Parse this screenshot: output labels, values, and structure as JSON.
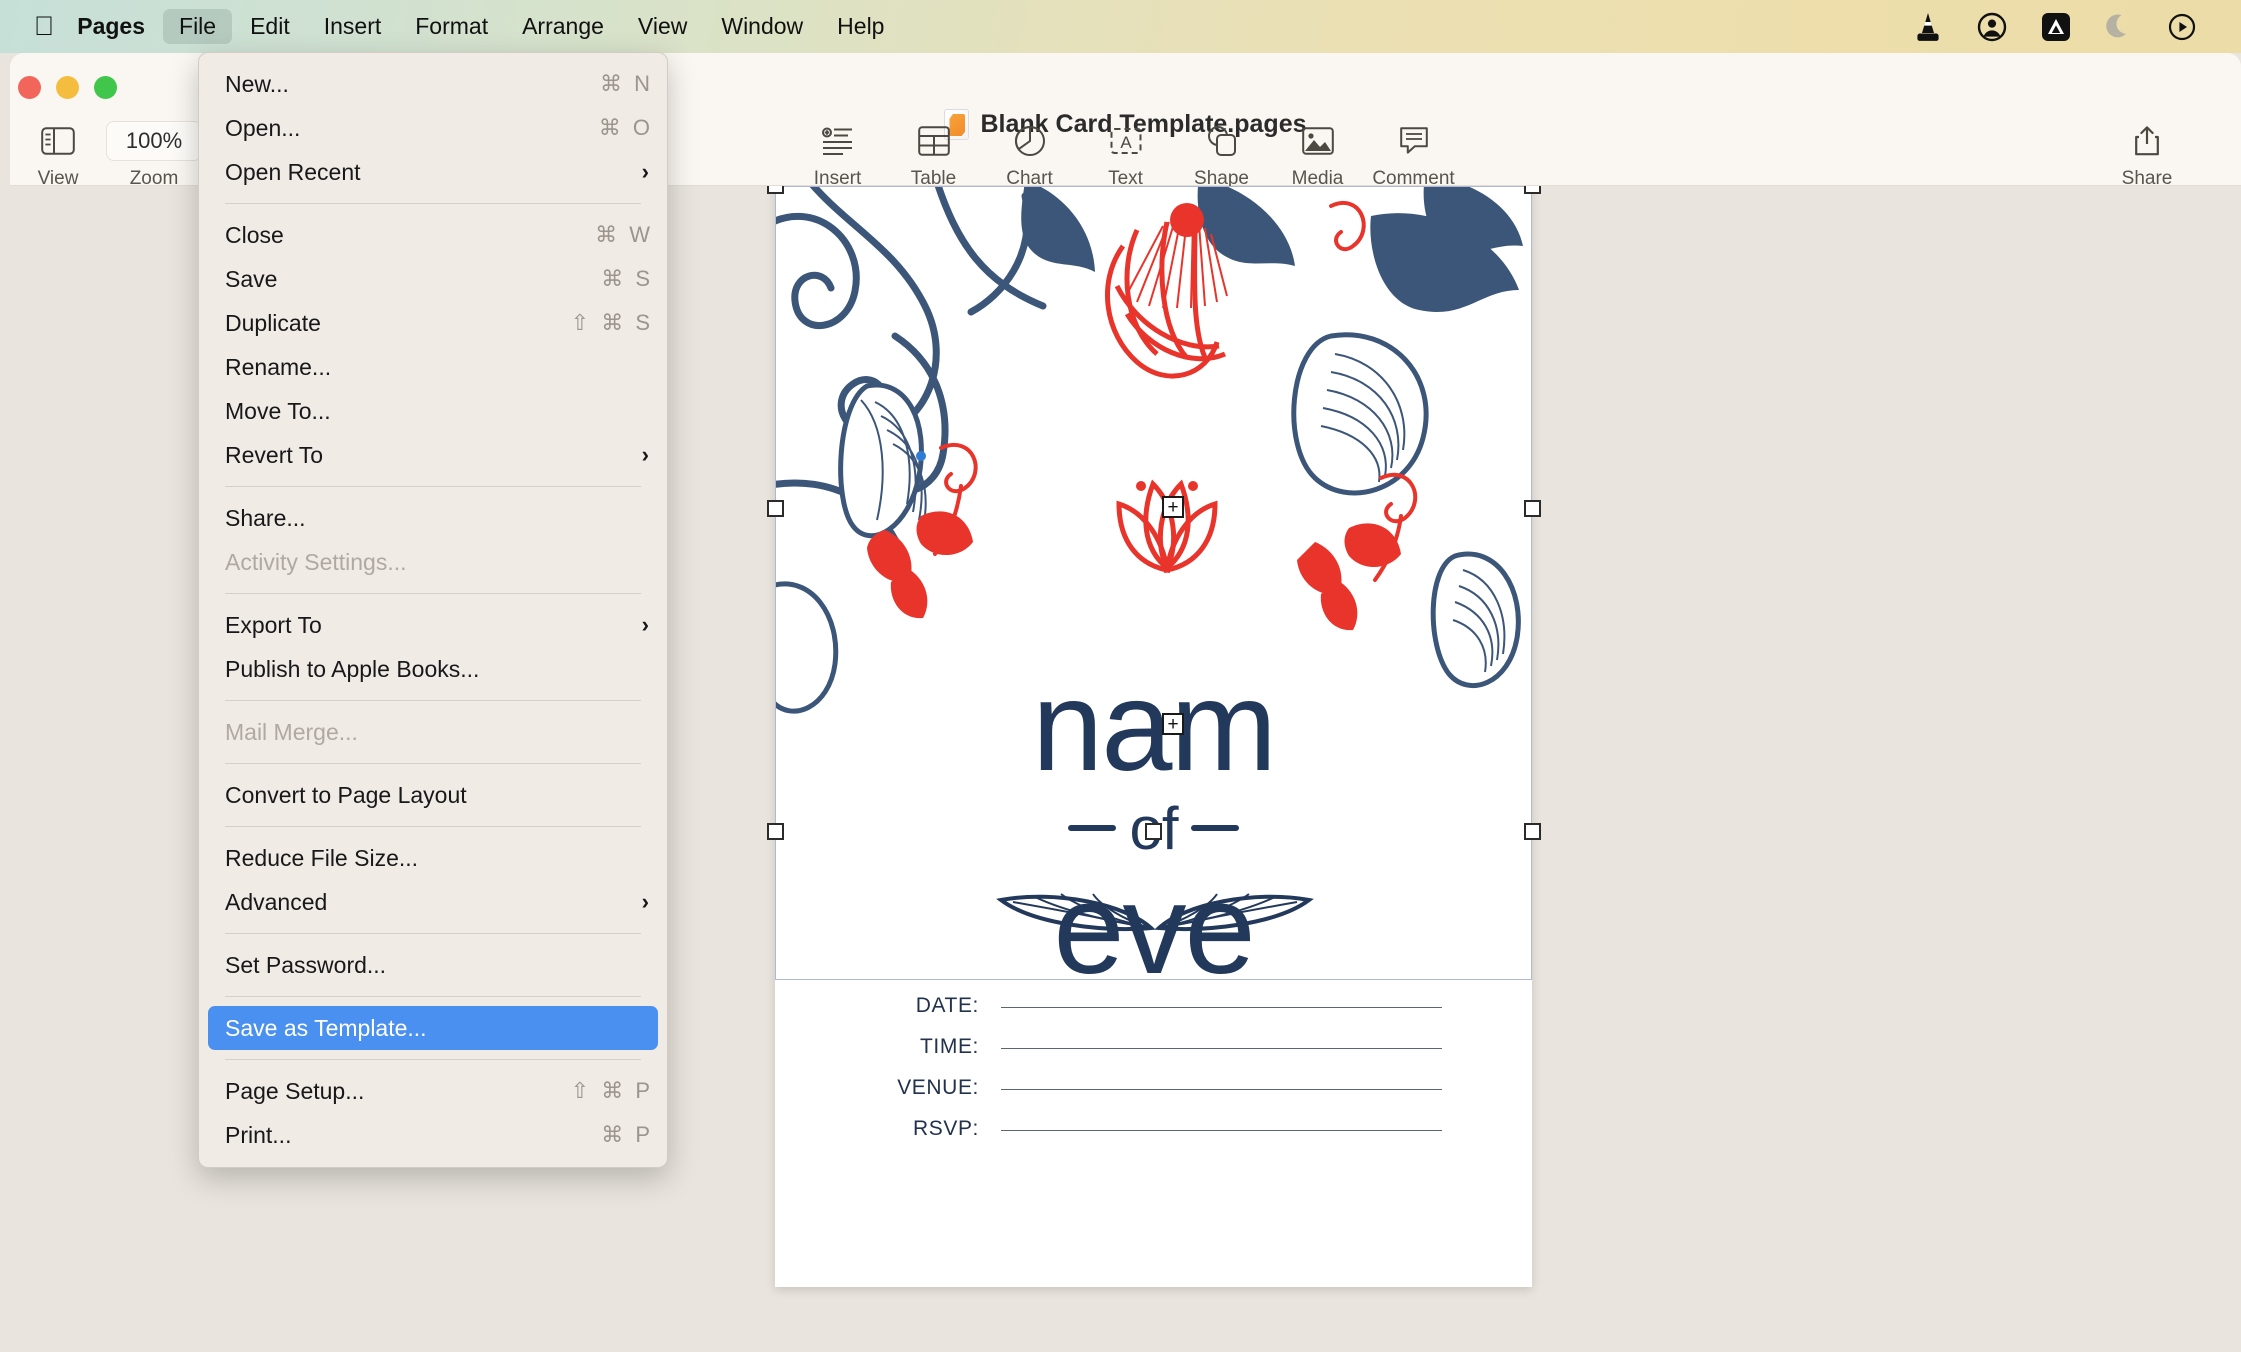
{
  "menubar": {
    "apple_glyph": "&#63743;",
    "items": [
      {
        "label": "Pages",
        "bold": true,
        "open": false
      },
      {
        "label": "File",
        "bold": false,
        "open": true
      },
      {
        "label": "Edit",
        "bold": false,
        "open": false
      },
      {
        "label": "Insert",
        "bold": false,
        "open": false
      },
      {
        "label": "Format",
        "bold": false,
        "open": false
      },
      {
        "label": "Arrange",
        "bold": false,
        "open": false
      },
      {
        "label": "View",
        "bold": false,
        "open": false
      },
      {
        "label": "Window",
        "bold": false,
        "open": false
      },
      {
        "label": "Help",
        "bold": false,
        "open": false
      }
    ],
    "status_icons": [
      "vlc-cone-icon",
      "user-account-icon",
      "affinity-icon",
      "do-not-disturb-moon-icon",
      "control-center-play-icon"
    ]
  },
  "window": {
    "title": "Blank Card Template.pages",
    "title_icon": "pages-document-icon",
    "traffic_lights": [
      "close-button",
      "minimize-button",
      "zoom-button"
    ]
  },
  "toolbar": {
    "left": [
      {
        "label": "View",
        "icon": "sidebar-view-icon"
      },
      {
        "label": "Zoom",
        "icon": "zoom-level-field",
        "value": "100%"
      }
    ],
    "center": [
      {
        "label": "Insert",
        "icon": "insert-icon"
      },
      {
        "label": "Table",
        "icon": "table-icon"
      },
      {
        "label": "Chart",
        "icon": "chart-icon"
      },
      {
        "label": "Text",
        "icon": "text-icon"
      },
      {
        "label": "Shape",
        "icon": "shape-icon"
      },
      {
        "label": "Media",
        "icon": "media-icon"
      },
      {
        "label": "Comment",
        "icon": "comment-icon"
      }
    ],
    "right": [
      {
        "label": "Share",
        "icon": "share-icon"
      }
    ]
  },
  "file_menu": {
    "items": [
      {
        "label": "New...",
        "shortcut": "⌘ N",
        "type": "item"
      },
      {
        "label": "Open...",
        "shortcut": "⌘ O",
        "type": "item"
      },
      {
        "label": "Open Recent",
        "shortcut": "",
        "type": "submenu"
      },
      {
        "type": "separator"
      },
      {
        "label": "Close",
        "shortcut": "⌘ W",
        "type": "item"
      },
      {
        "label": "Save",
        "shortcut": "⌘ S",
        "type": "item"
      },
      {
        "label": "Duplicate",
        "shortcut": "⇧ ⌘ S",
        "type": "item"
      },
      {
        "label": "Rename...",
        "shortcut": "",
        "type": "item"
      },
      {
        "label": "Move To...",
        "shortcut": "",
        "type": "item"
      },
      {
        "label": "Revert To",
        "shortcut": "",
        "type": "submenu"
      },
      {
        "type": "separator"
      },
      {
        "label": "Share...",
        "shortcut": "",
        "type": "item"
      },
      {
        "label": "Activity Settings...",
        "shortcut": "",
        "type": "disabled"
      },
      {
        "type": "separator"
      },
      {
        "label": "Export To",
        "shortcut": "",
        "type": "submenu"
      },
      {
        "label": "Publish to Apple Books...",
        "shortcut": "",
        "type": "item"
      },
      {
        "type": "separator"
      },
      {
        "label": "Mail Merge...",
        "shortcut": "",
        "type": "disabled"
      },
      {
        "type": "separator"
      },
      {
        "label": "Convert to Page Layout",
        "shortcut": "",
        "type": "item"
      },
      {
        "type": "separator"
      },
      {
        "label": "Reduce File Size...",
        "shortcut": "",
        "type": "item"
      },
      {
        "label": "Advanced",
        "shortcut": "",
        "type": "submenu"
      },
      {
        "type": "separator"
      },
      {
        "label": "Set Password...",
        "shortcut": "",
        "type": "item"
      },
      {
        "type": "separator"
      },
      {
        "label": "Save as Template...",
        "shortcut": "",
        "type": "selected"
      },
      {
        "type": "separator"
      },
      {
        "label": "Page Setup...",
        "shortcut": "⇧ ⌘ P",
        "type": "item"
      },
      {
        "label": "Print...",
        "shortcut": "⌘ P",
        "type": "item"
      }
    ]
  },
  "document": {
    "name_line1": "nam",
    "of_label": "of",
    "name_line2": "eve",
    "fields": [
      {
        "label": "DATE:",
        "value": ""
      },
      {
        "label": "TIME:",
        "value": ""
      },
      {
        "label": "VENUE:",
        "value": ""
      },
      {
        "label": "RSVP:",
        "value": ""
      }
    ],
    "colors": {
      "navy": "#23395b",
      "red": "#e8342a",
      "selection_blue": "#4a90f0",
      "page_white": "#ffffff",
      "canvas": "#e9e4dd"
    }
  }
}
